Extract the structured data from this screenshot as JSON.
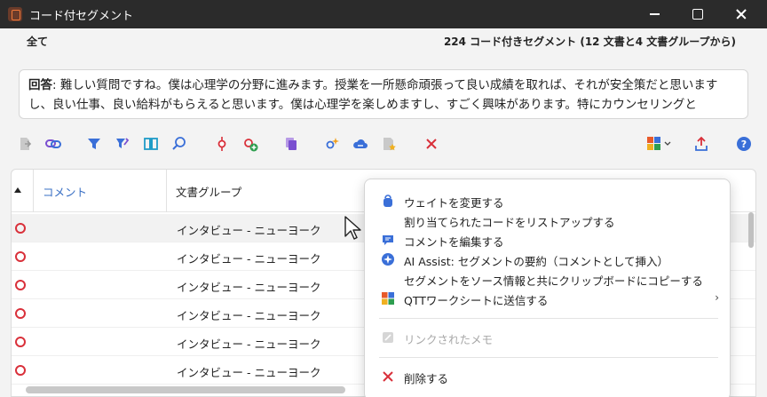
{
  "window": {
    "title": "コード付セグメント"
  },
  "header": {
    "scope_label": "全て",
    "segment_count": "224 コード付きセグメント (12 文書と4 文書グループから)"
  },
  "answer": {
    "label": "回答",
    "text": ": 難しい質問ですね。僕は心理学の分野に進みます。授業を一所懸命頑張って良い成績を取れば、それが安全策だと思いますし、良い仕事、良い給料がもらえると思います。僕は心理学を楽しめますし、すごく興味があります。特にカウンセリングと"
  },
  "toolbar": {
    "icons": [
      "export-doc-icon",
      "link-code-icon",
      "filter-icon",
      "filter-settings-icon",
      "columns-icon",
      "search-icon",
      "code-node-icon",
      "add-code-icon",
      "copy-icon",
      "ai-sparkle-icon",
      "cloud-icon",
      "memo-star-icon",
      "delete-icon",
      "smartpublisher-icon",
      "export-icon",
      "help-icon"
    ],
    "colors": {
      "blue": "#3a6fd8",
      "red": "#d9303a",
      "purple": "#7a4fd0",
      "teal": "#1f9cc7"
    }
  },
  "table": {
    "columns": [
      "コメント",
      "文書グループ"
    ],
    "rows": [
      {
        "comment": "",
        "doc_group": "インタビュー - ニューヨーク"
      },
      {
        "comment": "",
        "doc_group": "インタビュー - ニューヨーク"
      },
      {
        "comment": "",
        "doc_group": "インタビュー - ニューヨーク"
      },
      {
        "comment": "",
        "doc_group": "インタビュー - ニューヨーク"
      },
      {
        "comment": "",
        "doc_group": "インタビュー - ニューヨーク"
      },
      {
        "comment": "",
        "doc_group": "インタビュー - ニューヨーク"
      }
    ]
  },
  "context_menu": {
    "items": [
      {
        "label": "ウェイトを変更する",
        "icon": "weight-icon"
      },
      {
        "label": "割り当てられたコードをリストアップする",
        "icon": ""
      },
      {
        "label": "コメントを編集する",
        "icon": "comment-icon"
      },
      {
        "label": "AI Assist: セグメントの要約（コメントとして挿入）",
        "icon": "ai-assist-icon"
      },
      {
        "label": "セグメントをソース情報と共にクリップボードにコピーする",
        "icon": ""
      },
      {
        "label": "QTTワークシートに送信する",
        "icon": "qtt-icon",
        "submenu": "›"
      },
      {
        "label": "リンクされたメモ",
        "icon": "linked-memo-icon",
        "disabled": true
      },
      {
        "label": "削除する",
        "icon": "delete-x-icon"
      }
    ]
  }
}
